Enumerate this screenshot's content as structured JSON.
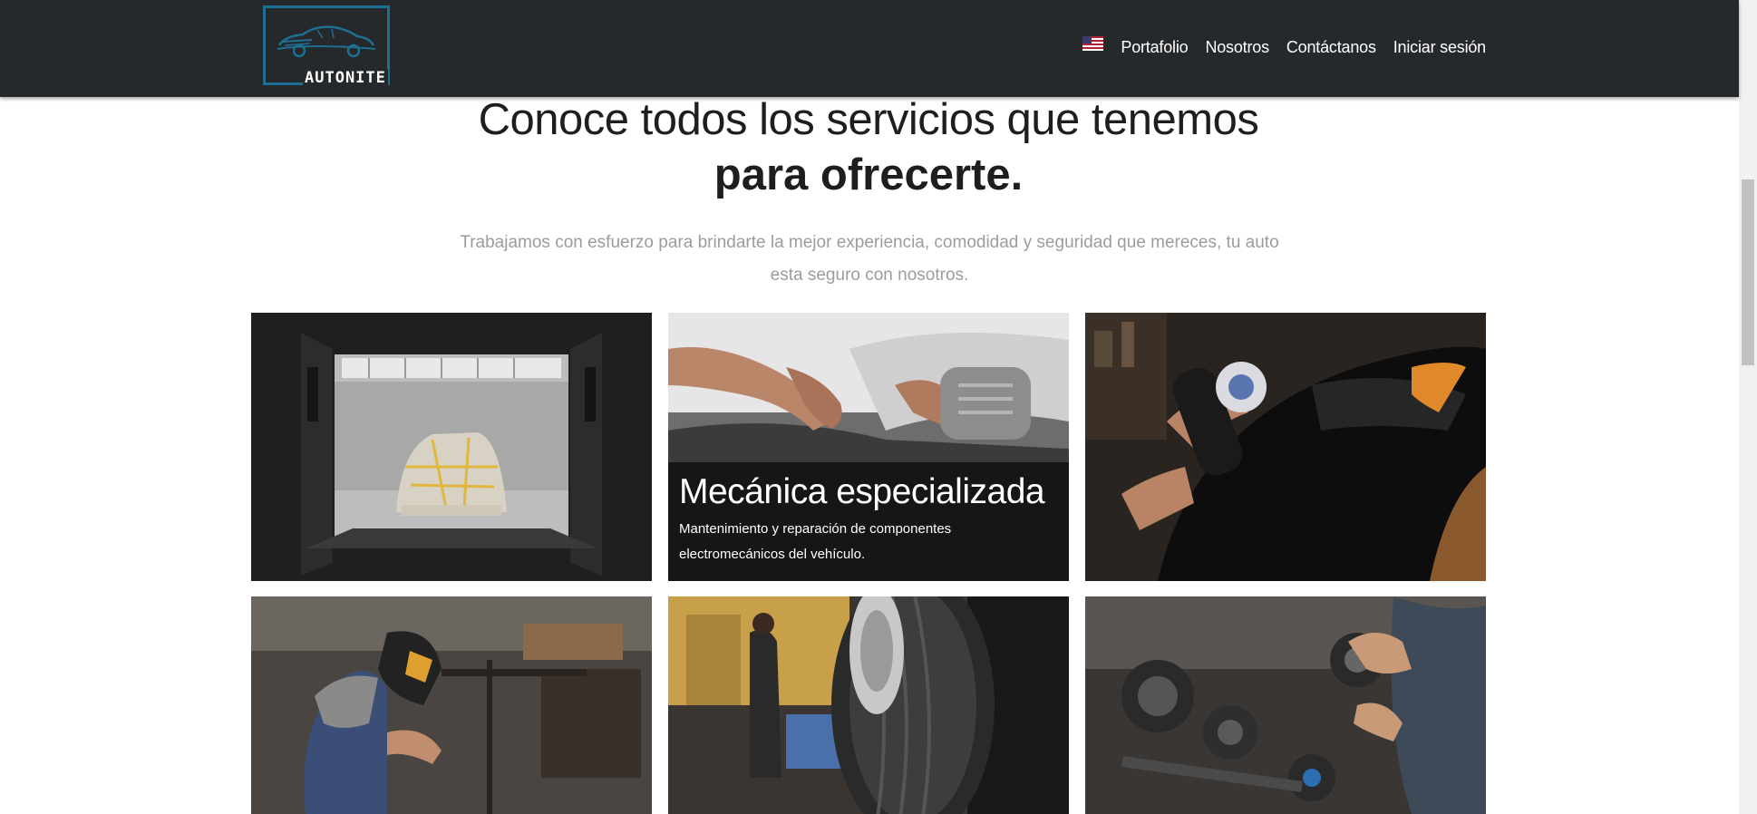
{
  "header": {
    "brand": "AUTONITE",
    "nav": [
      {
        "label": "Portafolio"
      },
      {
        "label": "Nosotros"
      },
      {
        "label": "Contáctanos"
      },
      {
        "label": "Iniciar sesión"
      }
    ]
  },
  "main": {
    "title_line1": "Conoce todos los servicios que tenemos",
    "title_line2": "para ofrecerte.",
    "subtitle": "Trabajamos con esfuerzo para brindarte la mejor experiencia, comodidad y seguridad que mereces, tu auto esta seguro con nosotros.",
    "services": [
      {
        "image": "paint-booth-photo"
      },
      {
        "image": "engine-repair-photo",
        "title": "Mecánica especializada",
        "description": "Mantenimiento y reparación de componentes electromecánicos del vehículo."
      },
      {
        "image": "car-polishing-photo"
      },
      {
        "image": "welding-photo"
      },
      {
        "image": "tire-service-photo"
      },
      {
        "image": "transmission-parts-photo"
      }
    ]
  },
  "colors": {
    "navbar": "#26292c",
    "logo_accent": "#1d6f93",
    "heading": "#1e1e1e",
    "subtitle": "#9c9c9c"
  }
}
